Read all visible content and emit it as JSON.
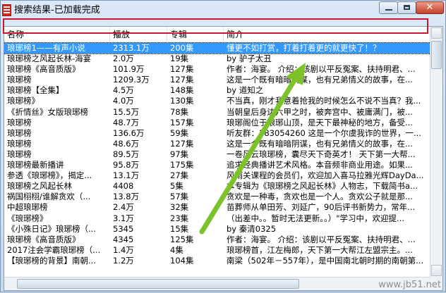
{
  "window": {
    "title": "搜索结果-已加载完成"
  },
  "columns": [
    "名称",
    "播放",
    "专辑",
    "简介"
  ],
  "rows": [
    [
      "琅琊榜1——有声小说",
      "2313.1万",
      "200集",
      "懂更不如打赏，打着打着更的就更快了！？"
    ],
    [
      "琅琊榜之风起长林-海宴",
      "2.0万",
      "19集",
      "by 驴子太丑"
    ],
    [
      "琅琊榜《高音质版》",
      "101.9万",
      "127集",
      "作者：海宴。 介绍：该剧以平反冤案、扶持明君、..."
    ],
    [
      "琅琊榜",
      "1209.3万",
      "127集",
      "这是一个既有暗暗阴谋，也有兄弟情义的故事，在..."
    ],
    [
      "琅琊榜【全集】",
      "4.5万",
      "148集",
      "by 道知之"
    ],
    [
      "琅琊榜》",
      "4.0万",
      "130集",
      "不当真，刚才我意着抢我的时候怎么不说不当真？我..."
    ],
    [
      "《折情丝》女版琅琊榜",
      "15.5万",
      "78集",
      "当朝皇后身边六甲之时，被奔宫中、被庸满门，被..."
    ],
    [
      "琅琊榜",
      "48.7万",
      "157集",
      "琅琊阁位于琅琊山顶，是天下最神秘的地方，备受..."
    ],
    [
      "琅琊榜",
      "136.6万",
      "59集",
      "听友群：283054260 这是一个尔虞我诈的世界，一..."
    ],
    [
      "琅琊榜",
      "48.6万",
      "127集",
      "这是一个既有暗暗阴谋，也有兄弟情义的故事，在..."
    ],
    [
      "琅琊榜",
      "89.5万",
      "97集",
      "一卷风云琅琊榜，囊尽天下奇英才！ 天下第一大帮..."
    ],
    [
      "琅琊榜最新播讲",
      "95.8万",
      "175集",
      "追求经典播讲艺术风格。本音频非商业用途。如果..."
    ],
    [
      "参透《琅琊榜》，揭定...",
      "13.1万",
      "27集",
      "风雨关课程的会员们，欢迎加入喜马拉雅光辉DayDa..."
    ],
    [
      "琅琊榜之风起长林",
      "4408",
      "5集",
      "本专辑为《琅琊榜之风起长林》人物志，下载简书a..."
    ],
    [
      "祸国栩栩/谁解贪欢（...",
      "13.8万",
      "57集",
      "贪欢是一种毒，贪欢也是一个人。贪欢公子就是那..."
    ],
    [
      "中超琅琊榜",
      "2.4万",
      "32集",
      "苗葬师从单田芳、刘延广，90后评书新势力，常年..."
    ],
    [
      "《琅琊榜》",
      "3.1万",
      "23集",
      "（出差中。。暂时无法更新。。）\"学习中，欢迎提..."
    ],
    [
      "《小殊日记》琅琊榜（...",
      "5345",
      "15集",
      "by 秦清0325"
    ],
    [
      "琅琊榜《高音质版》",
      "4345",
      "125集",
      "作者：海宴。 介绍：该剧以平反冤案、扶持明君、..."
    ],
    [
      "2017注会学霸琅琊榜（...",
      "1.4万",
      "4集",
      "琅琊榜首，江左梅郎，天下第一大帮江左盟宗主。..."
    ],
    [
      "【琅琊榜的背景】南朝...",
      "1.2万",
      "104集",
      "南梁（502年－557年），是中国南北朝时期的南朝第..."
    ]
  ],
  "watermark": "www.jb51.net",
  "colors": {
    "selection": "#3399ff",
    "highlight_box": "#c8172e",
    "arrow": "#7cc22a"
  }
}
